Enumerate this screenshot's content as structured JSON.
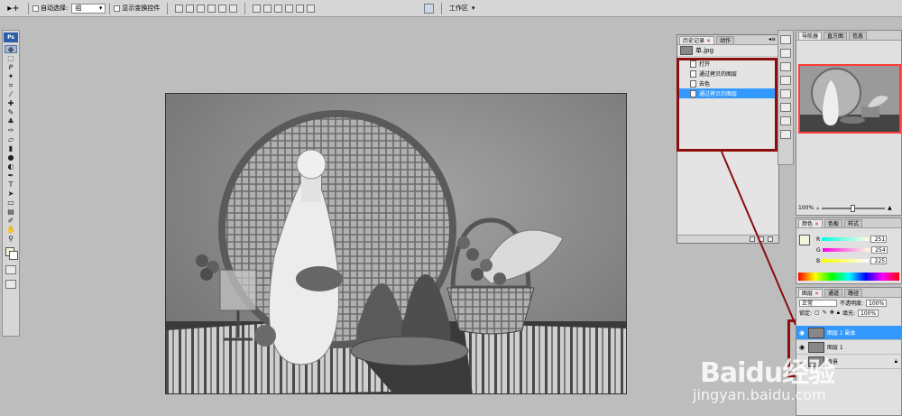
{
  "options_bar": {
    "auto_select_label": "自动选择:",
    "auto_select_value": "组",
    "show_transform_label": "显示变换控件",
    "workspace_label": "工作区"
  },
  "toolbox": {
    "logo": "Ps"
  },
  "history_panel": {
    "tabs": [
      "历史记录",
      "动作"
    ],
    "snapshot_label": "单.jpg",
    "items": [
      "打开",
      "通过拷贝的图层",
      "去色",
      "通过拷贝的图层"
    ],
    "selected_index": 3
  },
  "navigator_panel": {
    "tabs": [
      "导航器",
      "直方图",
      "信息"
    ],
    "zoom": "100%"
  },
  "color_panel": {
    "tabs": [
      "颜色",
      "色板",
      "样式"
    ],
    "channels": [
      {
        "label": "R",
        "value": "251"
      },
      {
        "label": "G",
        "value": "254"
      },
      {
        "label": "B",
        "value": "225"
      }
    ],
    "foreground_color": "#fbfee1"
  },
  "layers_panel": {
    "tabs": [
      "图层",
      "通道",
      "路径"
    ],
    "blend_mode": "正常",
    "opacity_label": "不透明度:",
    "opacity_value": "100%",
    "lock_label": "锁定:",
    "fill_label": "填充:",
    "fill_value": "100%",
    "layers": [
      {
        "name": "图层 1 副本",
        "selected": true
      },
      {
        "name": "图层 1",
        "selected": false
      },
      {
        "name": "背景",
        "selected": false
      }
    ]
  },
  "watermark": {
    "brand": "Baidu经验",
    "url": "jingyan.baidu.com"
  },
  "colors": {
    "selection_blue": "#3399ff",
    "annotation_red": "#8b0d0d"
  }
}
